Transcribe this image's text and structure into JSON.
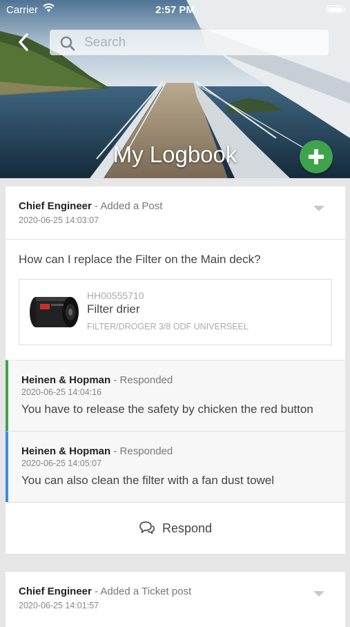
{
  "status_bar": {
    "carrier": "Carrier",
    "time": "2:57 PM"
  },
  "header": {
    "title": "My Logbook",
    "search_placeholder": "Search"
  },
  "posts": [
    {
      "author": "Chief Engineer",
      "action": " - Added a Post",
      "timestamp": "2020-06-25 14:03:07",
      "question": "How can I replace the Filter on the Main deck?",
      "product": {
        "sku": "HH00555710",
        "name": "Filter drier",
        "description": "FILTER/DROGER 3/8 ODF UNIVERSEEL"
      },
      "responses": [
        {
          "author": "Heinen & Hopman",
          "action": " - Responded",
          "timestamp": "2020-06-25 14:04:16",
          "text": "You have to release the safety by chicken the red button",
          "accent": "#3fa34d"
        },
        {
          "author": "Heinen & Hopman",
          "action": " - Responded",
          "timestamp": "2020-06-25 14:05:07",
          "text": "You can also clean the filter with a fan dust towel",
          "accent": "#3b8fd9"
        }
      ],
      "respond_label": "Respond"
    },
    {
      "author": "Chief Engineer",
      "action": " - Added a Ticket post",
      "timestamp": "2020-06-25 14:01:57"
    }
  ],
  "colors": {
    "fab": "#3fa34d",
    "accent_green": "#3fa34d",
    "accent_blue": "#3b8fd9"
  },
  "icons": [
    "wifi-icon",
    "battery-icon",
    "back-arrow-icon",
    "search-icon",
    "plus-icon",
    "chevron-down-icon",
    "chat-bubbles-icon"
  ]
}
